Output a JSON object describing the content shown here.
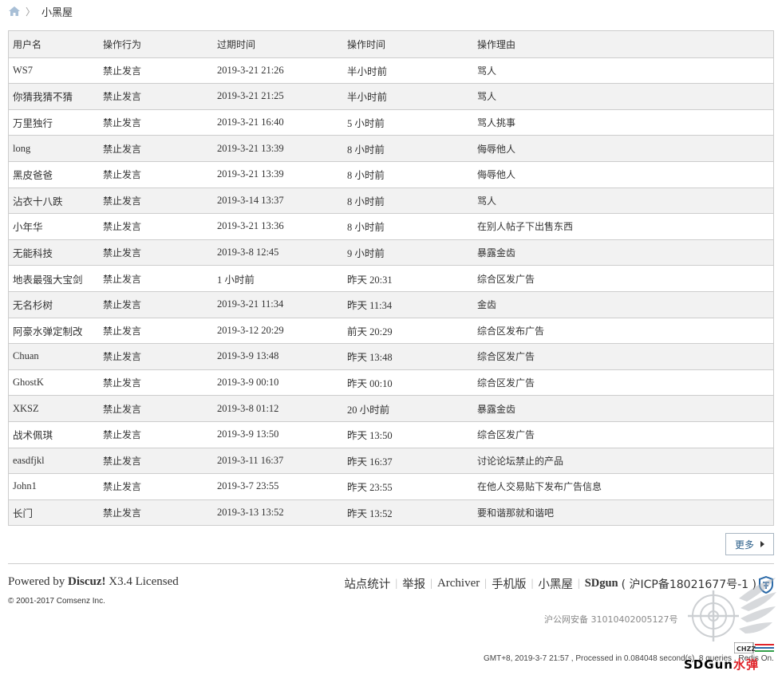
{
  "breadcrumb": {
    "current": "小黑屋"
  },
  "table": {
    "headers": [
      "用户名",
      "操作行为",
      "过期时间",
      "操作时间",
      "操作理由"
    ],
    "rows": [
      [
        "WS7",
        "禁止发言",
        "2019-3-21 21:26",
        "半小时前",
        "骂人"
      ],
      [
        "你猜我猜不猜",
        "禁止发言",
        "2019-3-21 21:25",
        "半小时前",
        "骂人"
      ],
      [
        "万里独行",
        "禁止发言",
        "2019-3-21 16:40",
        "5 小时前",
        "骂人挑事"
      ],
      [
        "long",
        "禁止发言",
        "2019-3-21 13:39",
        "8 小时前",
        "侮辱他人"
      ],
      [
        "黑皮爸爸",
        "禁止发言",
        "2019-3-21 13:39",
        "8 小时前",
        "侮辱他人"
      ],
      [
        "沾衣十八跌",
        "禁止发言",
        "2019-3-14 13:37",
        "8 小时前",
        "骂人"
      ],
      [
        "小年华",
        "禁止发言",
        "2019-3-21 13:36",
        "8 小时前",
        "在别人帖子下出售东西"
      ],
      [
        "无能科技",
        "禁止发言",
        "2019-3-8 12:45",
        "9 小时前",
        "暴露金齿"
      ],
      [
        "地表最强大宝剑",
        "禁止发言",
        "1 小时前",
        "昨天 20:31",
        "综合区发广告"
      ],
      [
        "无名杉树",
        "禁止发言",
        "2019-3-21 11:34",
        "昨天 11:34",
        "金齿"
      ],
      [
        "阿豪水弹定制改",
        "禁止发言",
        "2019-3-12 20:29",
        "前天 20:29",
        "综合区发布广告"
      ],
      [
        "Chuan",
        "禁止发言",
        "2019-3-9 13:48",
        "昨天 13:48",
        "综合区发广告"
      ],
      [
        "GhostK",
        "禁止发言",
        "2019-3-9 00:10",
        "昨天 00:10",
        "综合区发广告"
      ],
      [
        "XKSZ",
        "禁止发言",
        "2019-3-8 01:12",
        "20 小时前",
        "暴露金齿"
      ],
      [
        "战术佩琪",
        "禁止发言",
        "2019-3-9 13:50",
        "昨天 13:50",
        "综合区发广告"
      ],
      [
        "easdfjkl",
        "禁止发言",
        "2019-3-11 16:37",
        "昨天 16:37",
        "讨论论坛禁止的产品"
      ],
      [
        "John1",
        "禁止发言",
        "2019-3-7 23:55",
        "昨天 23:55",
        "在他人交易贴下发布广告信息"
      ],
      [
        "长门",
        "禁止发言",
        "2019-3-13 13:52",
        "昨天 13:52",
        "要和谐那就和谐吧"
      ]
    ]
  },
  "more_label": "更多",
  "footer": {
    "powered_prefix": "Powered by",
    "powered_brand": "Discuz!",
    "powered_suffix": "X3.4 Licensed",
    "copyright": "© 2001-2017 Comsenz Inc.",
    "links": [
      "站点统计",
      "举报",
      "Archiver",
      "手机版",
      "小黑屋"
    ],
    "site_name": "SDgun",
    "icp": "( 沪ICP备18021677号-1 )",
    "police": "沪公网安备 31010402005127号",
    "gmt": "GMT+8, 2019-3-7 21:57 , Processed in 0.084048 second(s), 8 queries , Redis On."
  },
  "watermark": {
    "brand": "SDGun",
    "brand_cn": "水弹",
    "badge": "CHZZ"
  },
  "colors": {
    "border": "#cdcdcd",
    "header_bg": "#f2f2f2",
    "link": "#2b5f8a"
  },
  "icons": {
    "home": "home-icon",
    "shield": "police-shield-icon",
    "more": "triangle-right-icon"
  }
}
